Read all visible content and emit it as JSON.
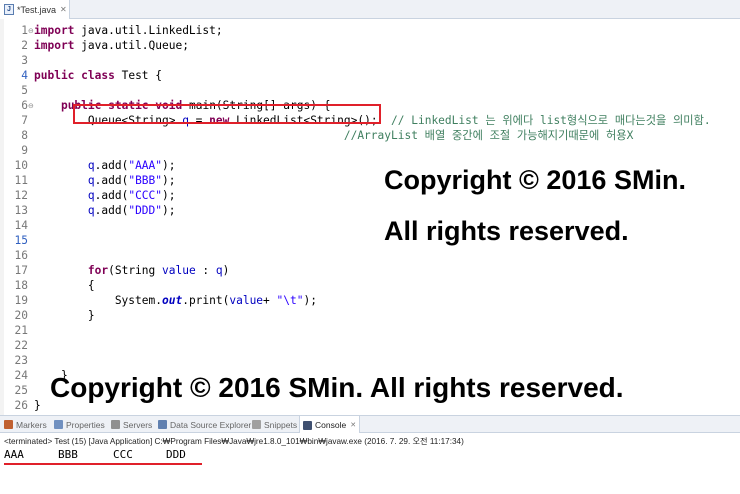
{
  "editor_tab": {
    "label": "*Test.java",
    "close": "✕"
  },
  "lines": [
    {
      "n": "1",
      "fold": "⊖",
      "tokens": [
        [
          "kw",
          "import"
        ],
        [
          "p",
          " java.util.LinkedList;"
        ]
      ]
    },
    {
      "n": "2",
      "tokens": [
        [
          "kw",
          "import"
        ],
        [
          "p",
          " java.util.Queue;"
        ]
      ]
    },
    {
      "n": "3",
      "tokens": []
    },
    {
      "n": "4",
      "hl": true,
      "tokens": [
        [
          "kw",
          "public"
        ],
        [
          "p",
          " "
        ],
        [
          "kw",
          "class"
        ],
        [
          "p",
          " Test {"
        ]
      ]
    },
    {
      "n": "5",
      "tokens": []
    },
    {
      "n": "6",
      "fold": "⊖",
      "tokens": [
        [
          "p",
          "    "
        ],
        [
          "kw",
          "public"
        ],
        [
          "p",
          " "
        ],
        [
          "kw",
          "static"
        ],
        [
          "p",
          " "
        ],
        [
          "kw",
          "void"
        ],
        [
          "p",
          " main(String[] args) {"
        ]
      ]
    },
    {
      "n": "7",
      "tokens": [
        [
          "p",
          "        Queue<String> "
        ],
        [
          "var",
          "q"
        ],
        [
          "p",
          " = "
        ],
        [
          "kw",
          "new"
        ],
        [
          "p",
          " LinkedList<String>();  "
        ],
        [
          "cm",
          "// LinkedList 는 위에다 list형식으로 매다는것을 의미함."
        ]
      ]
    },
    {
      "n": "8",
      "tokens": [
        [
          "p",
          "                                              "
        ],
        [
          "cm",
          "//ArrayList 배열 중간에 조절 가능해지기때문에 허용X"
        ]
      ]
    },
    {
      "n": "9",
      "tokens": []
    },
    {
      "n": "10",
      "tokens": [
        [
          "p",
          "        "
        ],
        [
          "var",
          "q"
        ],
        [
          "p",
          ".add("
        ],
        [
          "str",
          "\"AAA\""
        ],
        [
          "p",
          ");"
        ]
      ]
    },
    {
      "n": "11",
      "tokens": [
        [
          "p",
          "        "
        ],
        [
          "var",
          "q"
        ],
        [
          "p",
          ".add("
        ],
        [
          "str",
          "\"BBB\""
        ],
        [
          "p",
          ");"
        ]
      ]
    },
    {
      "n": "12",
      "tokens": [
        [
          "p",
          "        "
        ],
        [
          "var",
          "q"
        ],
        [
          "p",
          ".add("
        ],
        [
          "str",
          "\"CCC\""
        ],
        [
          "p",
          ");"
        ]
      ]
    },
    {
      "n": "13",
      "tokens": [
        [
          "p",
          "        "
        ],
        [
          "var",
          "q"
        ],
        [
          "p",
          ".add("
        ],
        [
          "str",
          "\"DDD\""
        ],
        [
          "p",
          ");"
        ]
      ]
    },
    {
      "n": "14",
      "tokens": []
    },
    {
      "n": "15",
      "hl": true,
      "tokens": []
    },
    {
      "n": "16",
      "tokens": []
    },
    {
      "n": "17",
      "tokens": [
        [
          "p",
          "        "
        ],
        [
          "kw",
          "for"
        ],
        [
          "p",
          "(String "
        ],
        [
          "var",
          "value"
        ],
        [
          "p",
          " : "
        ],
        [
          "var",
          "q"
        ],
        [
          "p",
          ")"
        ]
      ]
    },
    {
      "n": "18",
      "tokens": [
        [
          "p",
          "        {"
        ]
      ]
    },
    {
      "n": "19",
      "tokens": [
        [
          "p",
          "            System."
        ],
        [
          "stat",
          "out"
        ],
        [
          "p",
          ".print("
        ],
        [
          "var",
          "value"
        ],
        [
          "p",
          "+ "
        ],
        [
          "str",
          "\"\\t\""
        ],
        [
          "p",
          ");"
        ]
      ]
    },
    {
      "n": "20",
      "tokens": [
        [
          "p",
          "        }"
        ]
      ]
    },
    {
      "n": "21",
      "tokens": []
    },
    {
      "n": "22",
      "tokens": []
    },
    {
      "n": "23",
      "tokens": []
    },
    {
      "n": "24",
      "tokens": [
        [
          "p",
          "    }"
        ]
      ]
    },
    {
      "n": "25",
      "tokens": []
    },
    {
      "n": "26",
      "tokens": [
        [
          "p",
          "}"
        ]
      ]
    }
  ],
  "watermark": {
    "line1": "Copyright © 2016 SMin.",
    "line2": "All rights reserved.",
    "bottom": "Copyright © 2016 SMin. All rights reserved."
  },
  "view_tabs": [
    {
      "label": "Markers",
      "color": "#c06030"
    },
    {
      "label": "Properties",
      "color": "#7090c0"
    },
    {
      "label": "Servers",
      "color": "#909090"
    },
    {
      "label": "Data Source Explorer",
      "color": "#6080b0"
    },
    {
      "label": "Snippets",
      "color": "#a0a0a0"
    },
    {
      "label": "Console",
      "color": "#405070",
      "active": true,
      "close": "✕"
    }
  ],
  "console": {
    "status": "<terminated> Test (15) [Java Application] C:₩Program Files₩Java₩jre1.8.0_101₩bin₩javaw.exe (2016. 7. 29. 오전 11:17:34)",
    "output": [
      "AAA",
      "BBB",
      "CCC",
      "DDD"
    ]
  },
  "colors": {
    "highlight_red": "#e0202a",
    "keyword": "#7f0055",
    "string": "#2a00ff",
    "comment": "#3f7f5f"
  }
}
